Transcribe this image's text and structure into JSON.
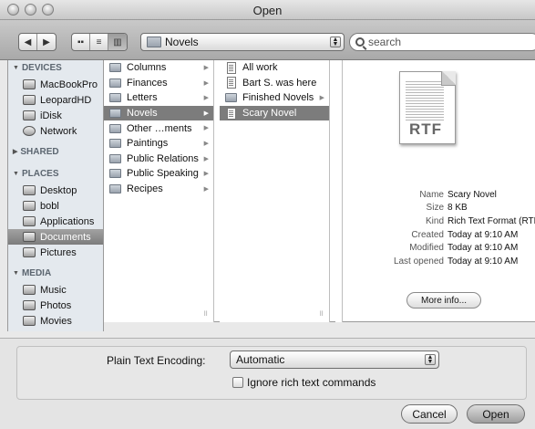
{
  "window": {
    "title": "Open"
  },
  "toolbar": {
    "location": "Novels",
    "search_placeholder": "search"
  },
  "sidebar": {
    "sections": [
      {
        "label": "DEVICES",
        "items": [
          "MacBookPro",
          "LeopardHD",
          "iDisk",
          "Network"
        ]
      },
      {
        "label": "SHARED",
        "items": []
      },
      {
        "label": "PLACES",
        "items": [
          "Desktop",
          "bobl",
          "Applications",
          "Documents",
          "Pictures"
        ]
      },
      {
        "label": "MEDIA",
        "items": [
          "Music",
          "Photos",
          "Movies"
        ]
      }
    ],
    "selected": "Documents"
  },
  "columns": {
    "col1": [
      "Columns",
      "Finances",
      "Letters",
      "Novels",
      "Other …ments",
      "Paintings",
      "Public Relations",
      "Public Speaking",
      "Recipes"
    ],
    "col1_selected": "Novels",
    "col2": [
      "All work",
      "Bart S. was here",
      "Finished Novels",
      "Scary Novel"
    ],
    "col2_selected": "Scary Novel"
  },
  "preview": {
    "icon_label": "RTF",
    "name_label": "Name",
    "name": "Scary Novel",
    "size_label": "Size",
    "size": "8 KB",
    "kind_label": "Kind",
    "kind": "Rich Text Format (RTF)",
    "created_label": "Created",
    "created": "Today at 9:10 AM",
    "modified_label": "Modified",
    "modified": "Today at 9:10 AM",
    "opened_label": "Last opened",
    "opened": "Today at 9:10 AM",
    "more_info": "More info..."
  },
  "options": {
    "encoding_label": "Plain Text Encoding:",
    "encoding_value": "Automatic",
    "ignore_label": "Ignore rich text commands"
  },
  "buttons": {
    "cancel": "Cancel",
    "open": "Open"
  }
}
